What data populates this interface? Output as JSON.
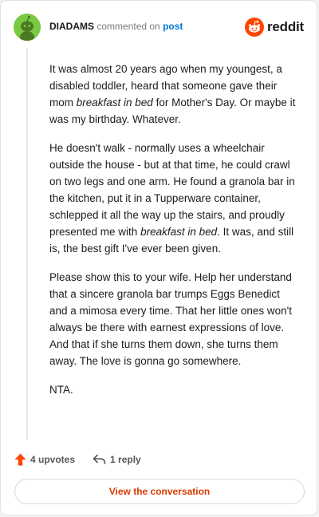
{
  "header": {
    "username": "DIADAMS",
    "action_text": "commented on",
    "post_link": "post",
    "brand": "reddit"
  },
  "comment": {
    "paragraphs": [
      [
        {
          "t": "It was almost 20 years ago when my youngest, a disabled toddler, heard that someone gave their mom "
        },
        {
          "t": "breakfast in bed",
          "i": true
        },
        {
          "t": " for Mother's Day. Or maybe it was my birthday. Whatever."
        }
      ],
      [
        {
          "t": "He doesn't walk - normally uses a wheelchair outside the house - but at that time, he could crawl on two legs and one arm. He found a granola bar in the kitchen, put it in a Tupperware container, schlepped it all the way up the stairs, and proudly presented me with "
        },
        {
          "t": "breakfast in bed",
          "i": true
        },
        {
          "t": ". It was, and still is, the best gift I've ever been given."
        }
      ],
      [
        {
          "t": "Please show this to your wife. Help her understand that a sincere granola bar trumps Eggs Benedict and a mimosa every time. That her little ones won't always be there with earnest expressions of love. And that if she turns them down, she turns them away. The love is gonna go somewhere."
        }
      ],
      [
        {
          "t": "NTA."
        }
      ]
    ]
  },
  "footer": {
    "upvotes": "4 upvotes",
    "replies": "1 reply",
    "view_button": "View the conversation"
  },
  "colors": {
    "accent": "#d93a00",
    "upvote": "#ff4500",
    "link": "#0079d3",
    "avatar": "#7ac943"
  },
  "icons": [
    "snoo-avatar-icon",
    "reddit-logo-icon",
    "upvote-arrow-icon",
    "reply-arrow-icon"
  ]
}
